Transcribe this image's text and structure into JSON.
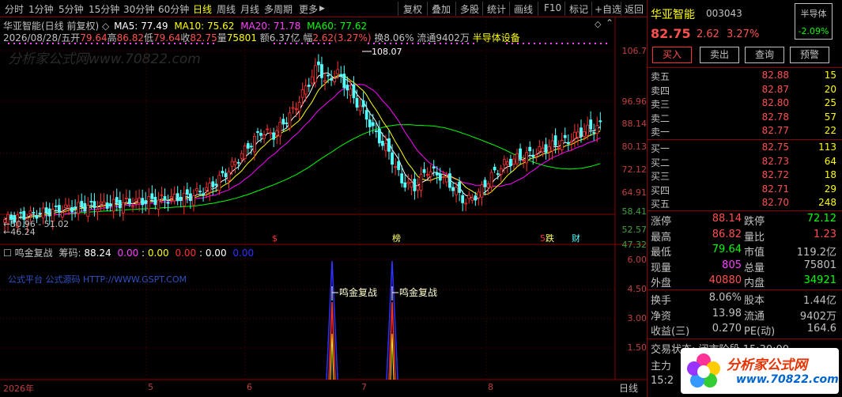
{
  "toolbar": {
    "left_items": [
      "分时",
      "1分钟",
      "5分钟",
      "15分钟",
      "30分钟",
      "60分钟",
      "日线",
      "周线",
      "月线",
      "多周期",
      "更多"
    ],
    "active": "日线",
    "more_arrow": "▶",
    "right_items": [
      "复权",
      "叠加",
      "多股",
      "统计",
      "画线",
      "F10",
      "标记",
      "+自选",
      "返回"
    ]
  },
  "chart": {
    "title": "华亚智能(日线 前复权)",
    "ma5": "MA5: 77.49",
    "ma10": "MA10: 75.62",
    "ma20": "MA20: 71.78",
    "ma60": "MA60: 77.62",
    "info": {
      "date": "2026/08/28/五",
      "open_lbl": "开",
      "open": "79.64",
      "high_lbl": "高",
      "high": "86.82",
      "low_lbl": "低",
      "low": "79.64",
      "close_lbl": "收",
      "close": "82.75",
      "vol_lbl": "量",
      "vol": "75801",
      "amt_lbl": "额",
      "amt": "6.37亿",
      "chg_lbl": "幅",
      "chg": "2.62(3.27%)",
      "turnover": "换8.06%",
      "float": "流通9402万",
      "sector": "半导体设备"
    },
    "high_marker": "108.07",
    "low_marker": "←46.24",
    "low_marker2": "←50.96 - 51.02",
    "price_ticks": [
      "106.7",
      "96.96",
      "88.14",
      "80.13",
      "72.12",
      "64.91",
      "58.41",
      "52.57",
      "47.32"
    ],
    "event_marks": {
      "s": "$",
      "bang": "榜",
      "five": "5",
      "die": "跌",
      "cai": "财"
    },
    "colors": {
      "up": "#ff3232",
      "down": "#54ffff",
      "ma5": "#ffffff",
      "ma10": "#ffff00",
      "ma20": "#ff00ff",
      "ma60": "#00ff00"
    }
  },
  "indicator": {
    "name": "鸣金复战",
    "chip_lbl": "筹码:",
    "vals": [
      "88.24",
      "0.00",
      "0.00",
      "0.00",
      "0.00",
      "0.00"
    ],
    "watermark_text": "公式平台 公式源码 HTTP://WWW.GSPT.COM",
    "signal_text": "鸣金复战",
    "ticks": [
      "6.00",
      "4.50",
      "3.00",
      "1.50"
    ]
  },
  "xaxis": {
    "labels": [
      "2026年",
      "5",
      "6",
      "7",
      "8"
    ],
    "period": "日线"
  },
  "quote": {
    "name": "华亚智能",
    "code": "003043",
    "sector_badge": "半导体",
    "badge_chg": "-2.09%",
    "price": "82.75",
    "change": "2.62",
    "pct": "3.27%",
    "buttons": [
      "买入",
      "卖出",
      "查询",
      "预警"
    ],
    "asks": [
      {
        "lbl": "卖五",
        "price": "82.88",
        "vol": "15"
      },
      {
        "lbl": "卖四",
        "price": "82.87",
        "vol": "20"
      },
      {
        "lbl": "卖三",
        "price": "82.80",
        "vol": "25"
      },
      {
        "lbl": "卖二",
        "price": "82.78",
        "vol": "57"
      },
      {
        "lbl": "卖一",
        "price": "82.77",
        "vol": "22"
      }
    ],
    "bids": [
      {
        "lbl": "买一",
        "price": "82.75",
        "vol": "113"
      },
      {
        "lbl": "买二",
        "price": "82.73",
        "vol": "64"
      },
      {
        "lbl": "买三",
        "price": "82.72",
        "vol": "18"
      },
      {
        "lbl": "买四",
        "price": "82.71",
        "vol": "29"
      },
      {
        "lbl": "买五",
        "price": "82.70",
        "vol": "248"
      }
    ],
    "stats": [
      {
        "l1": "涨停",
        "v1": "88.14",
        "l2": "跌停",
        "v2": "72.12"
      },
      {
        "l1": "最高",
        "v1": "86.82",
        "l2": "量比",
        "v2": "1.23"
      },
      {
        "l1": "最低",
        "v1": "79.64",
        "l2": "市值",
        "v2": "119.2亿"
      },
      {
        "l1": "现量",
        "v1": "805",
        "l2": "总量",
        "v2": "75801"
      },
      {
        "l1": "外盘",
        "v1": "40880",
        "l2": "内盘",
        "v2": "34921"
      }
    ],
    "stats2": [
      {
        "l1": "换手",
        "v1": "8.06%",
        "l2": "股本",
        "v2": "1.44亿"
      },
      {
        "l1": "净资",
        "v1": "13.98",
        "l2": "流通",
        "v2": "9402万"
      },
      {
        "l1": "收益(三)",
        "v1": "0.270",
        "l2": "PE(动)",
        "v2": "164.6"
      }
    ],
    "trade_status_lbl": "交易状态:",
    "trade_status": "闭市阶段",
    "trade_time": "15:30:00",
    "main_lbl": "主力",
    "time2": "15:2",
    "logo_text": "分析家公式网",
    "logo_url": "www.70822.com",
    "watermark": "分析家公式网www.70822.com"
  }
}
